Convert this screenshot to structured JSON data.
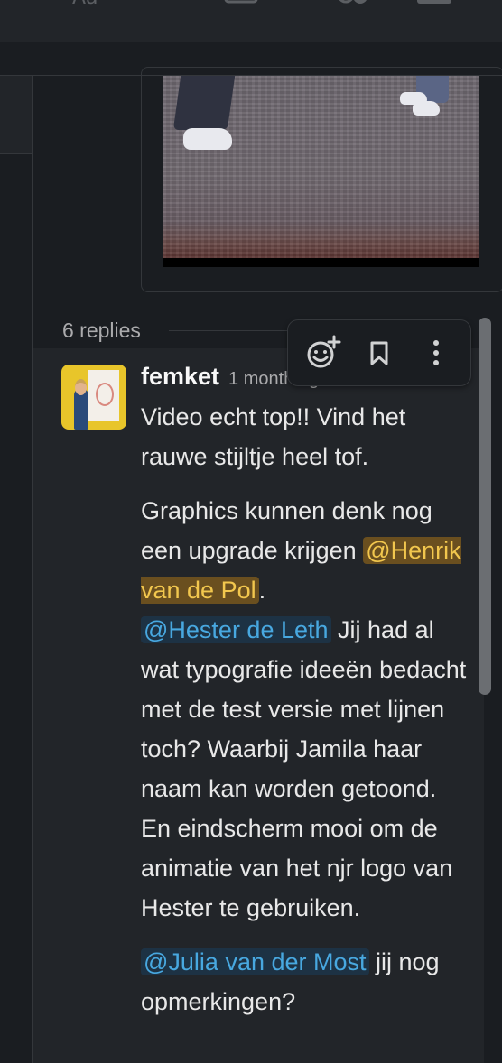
{
  "thread": {
    "replies_label": "6 replies"
  },
  "message": {
    "author": "femket",
    "timestamp": "1 month ago",
    "paragraphs": {
      "p1": "Video echt top!! Vind het rauwe stijltje heel tof.",
      "p2_before": "Graphics kunnen denk nog een upgrade krijgen ",
      "mention_henrik": "@Henrik van de Pol",
      "p2_after_henrik": ".",
      "mention_hester": "@Hester de Leth",
      "p2_after_hester": " Jij had al wat typografie ideeën bedacht met de test versie met lijnen toch? Waarbij Jamila haar naam kan worden getoond.",
      "p2_line2": "En eindscherm mooi om de animatie van het njr logo van Hester te gebruiken.",
      "mention_julia": "@Julia van der Most",
      "p3_after_julia": " jij nog opmerkingen?"
    }
  },
  "toolbar": {
    "icons": [
      "add-reaction-icon",
      "bookmark-icon",
      "more-actions-icon"
    ]
  },
  "colors": {
    "background": "#1a1d21",
    "mention_fg": "#48a8e0",
    "mention_self_bg": "#6a4f1f",
    "mention_self_fg": "#f2c74e"
  }
}
